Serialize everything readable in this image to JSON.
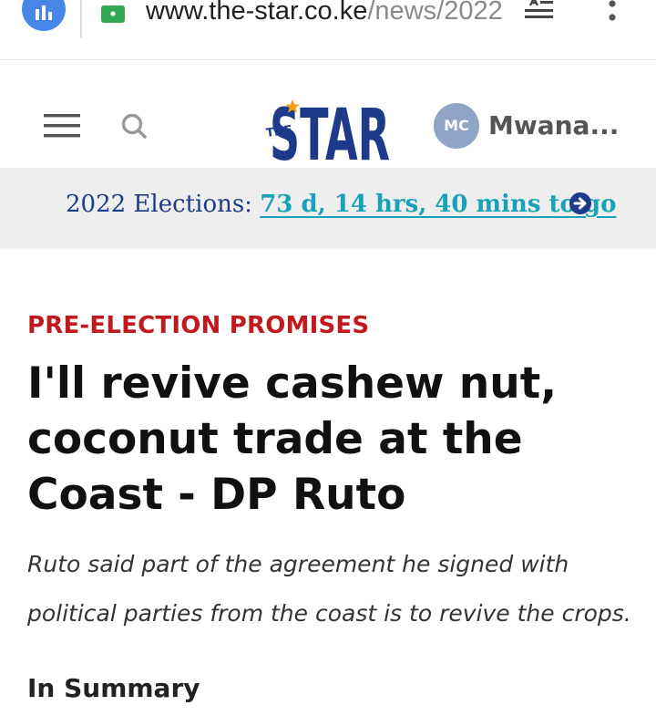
{
  "browser": {
    "url_domain": "www.the-star.co.ke",
    "url_path": "/news/2022",
    "icons": [
      "analytics-icon",
      "lock-icon",
      "reader-mode-icon",
      "more-vert-icon"
    ]
  },
  "header": {
    "logo_small": "THE",
    "logo_main": "STAR",
    "avatar_initials": "MC",
    "user_name": "Mwana...",
    "icons": [
      "hamburger-menu-icon",
      "search-icon"
    ]
  },
  "banner": {
    "label": "2022 Elections:",
    "countdown": "73 d, 14 hrs, 40 mins to go",
    "icon": "arrow-circle-right-icon"
  },
  "article": {
    "category": "PRE-ELECTION PROMISES",
    "headline": "I'll revive cashew nut, coconut trade at the Coast - DP Ruto",
    "lead": "Ruto said part of the agreement he signed with political parties from the coast is to revive the crops.",
    "summary_heading": "In Summary"
  },
  "colors": {
    "brand_blue": "#1e3a8a",
    "accent_teal": "#17a2b8",
    "category_red": "#c0191e",
    "chrome_blue": "#4a86e8",
    "lock_green": "#34a853",
    "star_orange": "#f39c12"
  }
}
